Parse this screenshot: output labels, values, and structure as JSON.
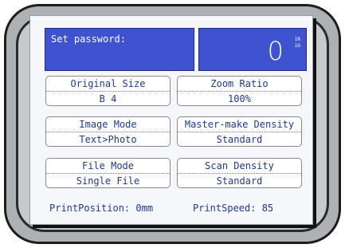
{
  "password": {
    "label": "Set password:"
  },
  "counter": {
    "value": "0",
    "unit_top": "1R",
    "unit_bottom": "1G"
  },
  "settings": [
    {
      "label": "Original Size",
      "value": "B 4"
    },
    {
      "label": "Zoom Ratio",
      "value": "100%"
    },
    {
      "label": "Image Mode",
      "value": "Text>Photo"
    },
    {
      "label": "Master-make Density",
      "value": "Standard"
    },
    {
      "label": "File Mode",
      "value": "Single File"
    },
    {
      "label": "Scan Density",
      "value": "Standard"
    }
  ],
  "footer": {
    "print_position": "PrintPosition: 0mm",
    "print_speed": "PrintSpeed: 85"
  },
  "colors": {
    "accent_panel": "#3f52cf",
    "text": "#1f3a90",
    "bezel": "#aeb1b3"
  }
}
